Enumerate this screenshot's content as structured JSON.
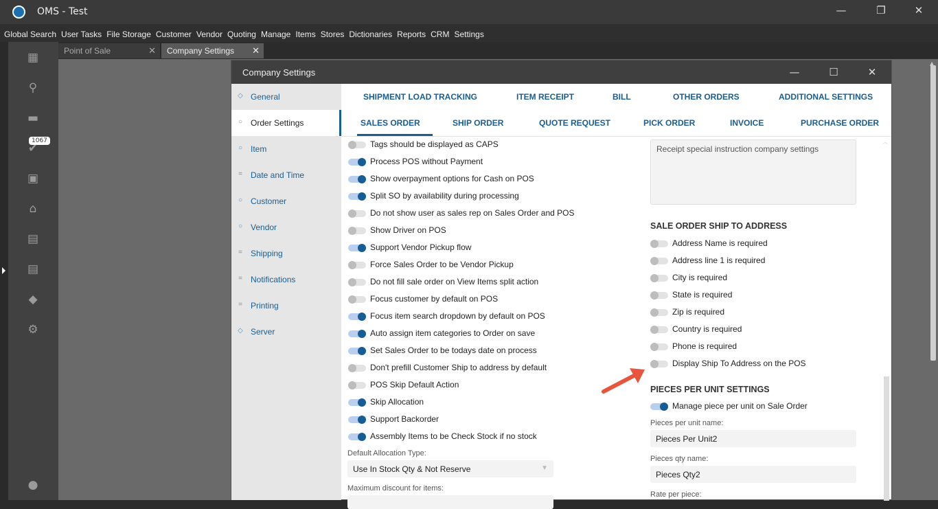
{
  "app": {
    "title": "OMS - Test"
  },
  "menu": [
    "Global Search",
    "User Tasks",
    "File Storage",
    "Customer",
    "Vendor",
    "Quoting",
    "Manage",
    "Items",
    "Stores",
    "Dictionaries",
    "Reports",
    "CRM",
    "Settings"
  ],
  "sidebar": {
    "badge": "1067"
  },
  "tabs": [
    {
      "label": "Point of Sale"
    },
    {
      "label": "Company Settings"
    }
  ],
  "dialog": {
    "title": "Company Settings",
    "nav": [
      {
        "label": "General",
        "icon": "diamond"
      },
      {
        "label": "Order Settings",
        "icon": "circle"
      },
      {
        "label": "Item",
        "icon": "circle"
      },
      {
        "label": "Date and Time",
        "icon": "lines"
      },
      {
        "label": "Customer",
        "icon": "circle"
      },
      {
        "label": "Vendor",
        "icon": "circle"
      },
      {
        "label": "Shipping",
        "icon": "lines"
      },
      {
        "label": "Notifications",
        "icon": "lines"
      },
      {
        "label": "Printing",
        "icon": "lines"
      },
      {
        "label": "Server",
        "icon": "diamond"
      }
    ],
    "tabs_row1": [
      "SHIPMENT LOAD TRACKING",
      "ITEM RECEIPT",
      "BILL",
      "OTHER ORDERS",
      "ADDITIONAL SETTINGS"
    ],
    "tabs_row2": [
      "SALES ORDER",
      "SHIP ORDER",
      "QUOTE REQUEST",
      "PICK ORDER",
      "INVOICE",
      "PURCHASE ORDER"
    ],
    "left_toggles": [
      {
        "label": "Tags should be displayed as CAPS",
        "on": false
      },
      {
        "label": "Process POS without Payment",
        "on": true
      },
      {
        "label": "Show overpayment options for Cash on POS",
        "on": true
      },
      {
        "label": "Split SO by availability during processing",
        "on": true
      },
      {
        "label": "Do not show user as sales rep on Sales Order and POS",
        "on": false
      },
      {
        "label": "Show Driver on POS",
        "on": false
      },
      {
        "label": "Support Vendor Pickup flow",
        "on": true
      },
      {
        "label": "Force Sales Order to be Vendor Pickup",
        "on": false
      },
      {
        "label": "Do not fill sale order on View Items split action",
        "on": false
      },
      {
        "label": "Focus customer by default on POS",
        "on": false
      },
      {
        "label": "Focus item search dropdown by default on POS",
        "on": true
      },
      {
        "label": "Auto assign item categories to Order on save",
        "on": true
      },
      {
        "label": "Set Sales Order to be todays date on process",
        "on": true
      },
      {
        "label": "Don't prefill Customer Ship to address by default",
        "on": false
      },
      {
        "label": "POS Skip Default Action",
        "on": false
      },
      {
        "label": "Skip Allocation",
        "on": true
      },
      {
        "label": "Support Backorder",
        "on": true
      },
      {
        "label": "Assembly Items to be Check Stock if no stock",
        "on": true
      }
    ],
    "allocation": {
      "label": "Default Allocation Type:",
      "value": "Use In Stock Qty & Not Reserve"
    },
    "max_discount": {
      "label": "Maximum discount for items:"
    },
    "receipt_placeholder": "Receipt special instruction company settings",
    "ship_to": {
      "heading": "SALE ORDER SHIP TO ADDRESS",
      "toggles": [
        {
          "label": "Address Name is required",
          "on": false
        },
        {
          "label": "Address line 1 is required",
          "on": false
        },
        {
          "label": "City is required",
          "on": false
        },
        {
          "label": "State is required",
          "on": false
        },
        {
          "label": "Zip is required",
          "on": false
        },
        {
          "label": "Country is required",
          "on": false
        },
        {
          "label": "Phone is required",
          "on": false
        },
        {
          "label": "Display Ship To Address on the POS",
          "on": false
        }
      ]
    },
    "ppu": {
      "heading": "PIECES PER UNIT SETTINGS",
      "toggle": {
        "label": "Manage piece per unit on Sale Order",
        "on": true
      },
      "name_label": "Pieces per unit name:",
      "name_value": "Pieces Per Unit2",
      "qty_label": "Pieces qty name:",
      "qty_value": "Pieces Qty2",
      "rate_label": "Rate per piece:"
    }
  },
  "colors": {
    "accent": "#155d94",
    "arrow": "#e8553e"
  }
}
